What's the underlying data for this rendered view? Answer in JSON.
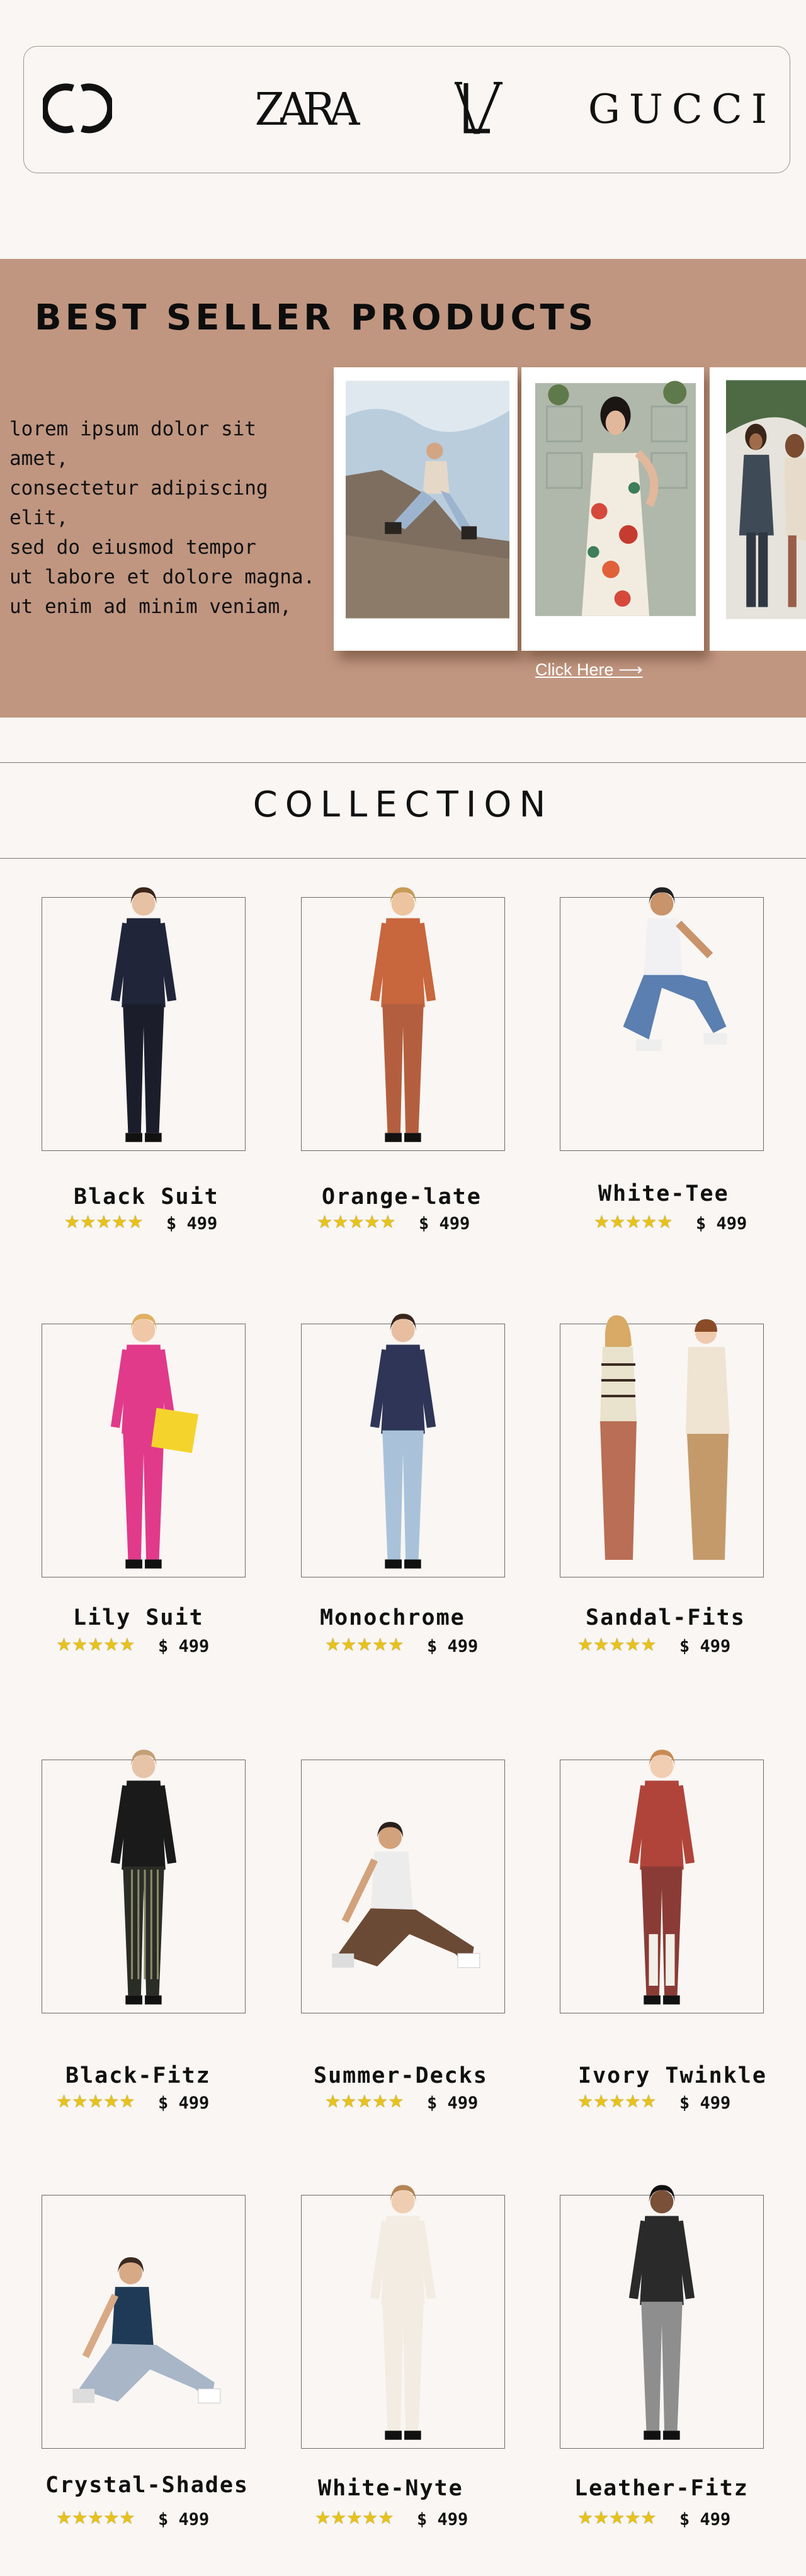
{
  "brands": {
    "logo1": "chanel-logo",
    "zara": "ZARA",
    "logo3": "louis-vuitton-logo",
    "gucci": "GUCCI"
  },
  "hero": {
    "title": "BEST SELLER PRODUCTS",
    "text": [
      "lorem ipsum dolor sit amet,",
      "consectetur adipiscing elit,",
      "sed do eiusmod tempor",
      "ut labore et dolore magna.",
      " ut enim ad minim veniam,"
    ],
    "cta": "Click Here ⟶"
  },
  "collection": {
    "title": "COLLECTION"
  },
  "products": [
    {
      "name": "Black Suit",
      "stars": "★★★★★",
      "price": "$ 499",
      "rating": 5
    },
    {
      "name": "Orange-late",
      "stars": "★★★★★",
      "price": "$ 499",
      "rating": 5
    },
    {
      "name": "White-Tee",
      "stars": "★★★★★",
      "price": "$ 499",
      "rating": 5
    },
    {
      "name": "Lily Suit",
      "stars": "★★★★★",
      "price": "$ 499",
      "rating": 5
    },
    {
      "name": "Monochrome",
      "stars": "★★★★★",
      "price": "$ 499",
      "rating": 5
    },
    {
      "name": "Sandal-Fits",
      "stars": "★★★★★",
      "price": "$ 499",
      "rating": 5
    },
    {
      "name": "Black-Fitz",
      "stars": "★★★★★",
      "price": "$ 499",
      "rating": 5
    },
    {
      "name": "Summer-Decks",
      "stars": "★★★★★",
      "price": "$ 499",
      "rating": 5
    },
    {
      "name": "Ivory Twinkle",
      "stars": "★★★★★",
      "price": "$ 499",
      "rating": 5
    },
    {
      "name": "Crystal-Shades",
      "stars": "★★★★★",
      "price": "$ 499",
      "rating": 5
    },
    {
      "name": "White-Nyte",
      "stars": "★★★★★",
      "price": "$ 499",
      "rating": 5
    },
    {
      "name": "Leather-Fitz",
      "stars": "★★★★★",
      "price": "$ 499",
      "rating": 5
    }
  ],
  "colors": {
    "page_bg": "#f9f6f3",
    "hero_bg": "#c09680",
    "star": "#e8c21a",
    "text": "#111111"
  }
}
